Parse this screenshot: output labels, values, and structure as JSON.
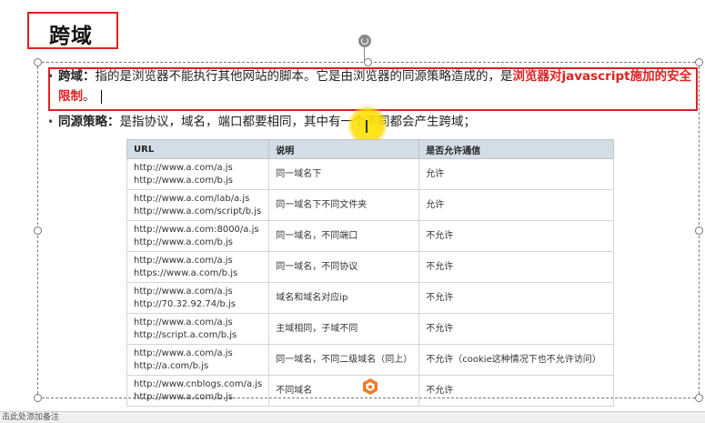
{
  "slide": {
    "title": "跨域",
    "para1": {
      "label": "跨域：",
      "text": "指的是浏览器不能执行其他网站的脚本。它是由浏览器的同源策略造成的，是",
      "emphasis": "浏览器对javascript施加的安全限制",
      "end": "。"
    },
    "para2": {
      "label": "同源策略：",
      "text": "是指协议，域名，端口都要相同，其中有一个不同都会产生跨域；"
    }
  },
  "table": {
    "headers": [
      "URL",
      "说明",
      "是否允许通信"
    ],
    "rows": [
      {
        "url1": "http://www.a.com/a.js",
        "url2": "http://www.a.com/b.js",
        "desc": "同一域名下",
        "allow": "允许"
      },
      {
        "url1": "http://www.a.com/lab/a.js",
        "url2": "http://www.a.com/script/b.js",
        "desc": "同一域名下不同文件夹",
        "allow": "允许"
      },
      {
        "url1": "http://www.a.com:8000/a.js",
        "url2": "http://www.a.com/b.js",
        "desc": "同一域名，不同端口",
        "allow": "不允许"
      },
      {
        "url1": "http://www.a.com/a.js",
        "url2": "https://www.a.com/b.js",
        "desc": "同一域名，不同协议",
        "allow": "不允许"
      },
      {
        "url1": "http://www.a.com/a.js",
        "url2": "http://70.32.92.74/b.js",
        "desc": "域名和域名对应ip",
        "allow": "不允许"
      },
      {
        "url1": "http://www.a.com/a.js",
        "url2": "http://script.a.com/b.js",
        "desc": "主域相同，子域不同",
        "allow": "不允许"
      },
      {
        "url1": "http://www.a.com/a.js",
        "url2": "http://a.com/b.js",
        "desc": "同一域名，不同二级域名（同上）",
        "allow": "不允许（cookie这种情况下也不允许访问）"
      },
      {
        "url1": "http://www.cnblogs.com/a.js",
        "url2": "http://www.a.com/b.js",
        "desc": "不同域名",
        "allow": "不允许"
      }
    ]
  },
  "notes_bar": "击此处添加备注",
  "icons": {
    "rotate": "rotate-icon",
    "logo": "app-logo-icon"
  },
  "colors": {
    "accent_red": "#e02020",
    "pointer_yellow": "#ffdd00",
    "table_header": "#d3dde8"
  }
}
